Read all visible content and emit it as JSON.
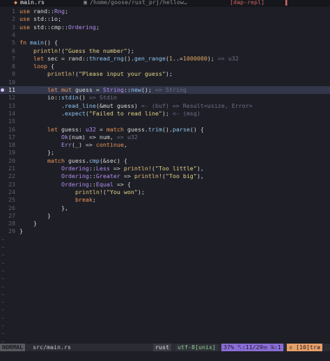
{
  "tabline": {
    "active_tab": {
      "icon": "rust-file-icon",
      "label": "main.rs"
    },
    "path_tab": {
      "icon": "folder-icon",
      "label": "/home/goose/rust_prj/hellow…"
    },
    "dap_tab": {
      "label": "[dap-repl]"
    },
    "close_glyph": "▌"
  },
  "editor": {
    "lines": [
      {
        "n": "1",
        "segs": [
          [
            "kw",
            "use "
          ],
          [
            "pl",
            "rand::"
          ],
          [
            "typ",
            "Rng"
          ],
          [
            "pl",
            ";"
          ]
        ]
      },
      {
        "n": "2",
        "segs": [
          [
            "kw",
            "use "
          ],
          [
            "pl",
            "std::"
          ],
          [
            "pl",
            "io"
          ],
          [
            "pl",
            ";"
          ]
        ]
      },
      {
        "n": "3",
        "segs": [
          [
            "kw",
            "use "
          ],
          [
            "pl",
            "std::cmp::"
          ],
          [
            "typ",
            "Ordering"
          ],
          [
            "pl",
            ";"
          ]
        ]
      },
      {
        "n": "4",
        "segs": []
      },
      {
        "n": "5",
        "segs": [
          [
            "kw",
            "fn "
          ],
          [
            "fn",
            "main"
          ],
          [
            "pl",
            "() {"
          ]
        ]
      },
      {
        "n": "6",
        "segs": [
          [
            "pl",
            "    "
          ],
          [
            "mac",
            "println!"
          ],
          [
            "pl",
            "("
          ],
          [
            "str",
            "\"Guess the number\""
          ],
          [
            "pl",
            ");"
          ]
        ]
      },
      {
        "n": "7",
        "segs": [
          [
            "pl",
            "    "
          ],
          [
            "kw",
            "let "
          ],
          [
            "pl",
            "sec = rand::"
          ],
          [
            "fn",
            "thread_rng"
          ],
          [
            "pl",
            "()."
          ],
          [
            "fn",
            "gen_range"
          ],
          [
            "pl",
            "("
          ],
          [
            "num",
            "1"
          ],
          [
            "pl",
            "..="
          ],
          [
            "num",
            "1000000"
          ],
          [
            "pl",
            ");"
          ],
          [
            "hint",
            " => u32"
          ]
        ]
      },
      {
        "n": "8",
        "segs": [
          [
            "pl",
            "    "
          ],
          [
            "kw",
            "loop "
          ],
          [
            "pl",
            "{"
          ]
        ]
      },
      {
        "n": "9",
        "segs": [
          [
            "pl",
            "        "
          ],
          [
            "mac",
            "println!"
          ],
          [
            "pl",
            "("
          ],
          [
            "str",
            "\"Please input your guess\""
          ],
          [
            "pl",
            ");"
          ]
        ]
      },
      {
        "n": "10",
        "segs": []
      },
      {
        "n": "11",
        "cur": true,
        "bp": true,
        "segs": [
          [
            "pl",
            "        "
          ],
          [
            "kw",
            "let mut "
          ],
          [
            "pl",
            "guess = "
          ],
          [
            "typ",
            "String"
          ],
          [
            "pl",
            "::"
          ],
          [
            "fn",
            "new"
          ],
          [
            "pl",
            "();"
          ],
          [
            "hint",
            " => String"
          ]
        ]
      },
      {
        "n": "12",
        "segs": [
          [
            "pl",
            "        io::"
          ],
          [
            "fn",
            "stdin"
          ],
          [
            "pl",
            "()"
          ],
          [
            "hint",
            " => Stdin"
          ]
        ]
      },
      {
        "n": "13",
        "segs": [
          [
            "pl",
            "            ."
          ],
          [
            "fn",
            "read_line"
          ],
          [
            "pl",
            "(&mut guess)"
          ],
          [
            "hint",
            " <- (buf) => Result<usize, Error>"
          ]
        ]
      },
      {
        "n": "14",
        "segs": [
          [
            "pl",
            "            ."
          ],
          [
            "fn",
            "expect"
          ],
          [
            "pl",
            "("
          ],
          [
            "str",
            "\"Failed to read line\""
          ],
          [
            "pl",
            ");"
          ],
          [
            "hint",
            " <- (msg)"
          ]
        ]
      },
      {
        "n": "15",
        "segs": []
      },
      {
        "n": "16",
        "segs": [
          [
            "pl",
            "        "
          ],
          [
            "kw",
            "let "
          ],
          [
            "pl",
            "guess: "
          ],
          [
            "typ",
            "u32"
          ],
          [
            "pl",
            " = "
          ],
          [
            "kw",
            "match "
          ],
          [
            "pl",
            "guess."
          ],
          [
            "fn",
            "trim"
          ],
          [
            "pl",
            "()."
          ],
          [
            "fn",
            "parse"
          ],
          [
            "pl",
            "() {"
          ]
        ]
      },
      {
        "n": "17",
        "segs": [
          [
            "pl",
            "            "
          ],
          [
            "typ",
            "Ok"
          ],
          [
            "pl",
            "(num) => num,"
          ],
          [
            "hint",
            " => u32"
          ]
        ]
      },
      {
        "n": "18",
        "segs": [
          [
            "pl",
            "            "
          ],
          [
            "typ",
            "Err"
          ],
          [
            "pl",
            "(_) => "
          ],
          [
            "kw",
            "continue"
          ],
          [
            "pl",
            ","
          ]
        ]
      },
      {
        "n": "19",
        "segs": [
          [
            "pl",
            "        };"
          ]
        ]
      },
      {
        "n": "20",
        "segs": [
          [
            "pl",
            "        "
          ],
          [
            "kw",
            "match "
          ],
          [
            "pl",
            "guess."
          ],
          [
            "fn",
            "cmp"
          ],
          [
            "pl",
            "(&sec) {"
          ]
        ]
      },
      {
        "n": "21",
        "segs": [
          [
            "pl",
            "            "
          ],
          [
            "typ",
            "Ordering"
          ],
          [
            "pl",
            "::"
          ],
          [
            "typ",
            "Less"
          ],
          [
            "pl",
            " => "
          ],
          [
            "mac",
            "println!"
          ],
          [
            "pl",
            "("
          ],
          [
            "str",
            "\"Too little\""
          ],
          [
            "pl",
            "),"
          ]
        ]
      },
      {
        "n": "22",
        "segs": [
          [
            "pl",
            "            "
          ],
          [
            "typ",
            "Ordering"
          ],
          [
            "pl",
            "::"
          ],
          [
            "typ",
            "Greater"
          ],
          [
            "pl",
            " => "
          ],
          [
            "mac",
            "println!"
          ],
          [
            "pl",
            "("
          ],
          [
            "str",
            "\"Too big\""
          ],
          [
            "pl",
            "),"
          ]
        ]
      },
      {
        "n": "23",
        "segs": [
          [
            "pl",
            "            "
          ],
          [
            "typ",
            "Ordering"
          ],
          [
            "pl",
            "::"
          ],
          [
            "typ",
            "Equal"
          ],
          [
            "pl",
            " => {"
          ]
        ]
      },
      {
        "n": "24",
        "segs": [
          [
            "pl",
            "                "
          ],
          [
            "mac",
            "println!"
          ],
          [
            "pl",
            "("
          ],
          [
            "str",
            "\"You won\""
          ],
          [
            "pl",
            ");"
          ]
        ]
      },
      {
        "n": "25",
        "segs": [
          [
            "pl",
            "                "
          ],
          [
            "kw",
            "break"
          ],
          [
            "pl",
            ";"
          ]
        ]
      },
      {
        "n": "26",
        "segs": [
          [
            "pl",
            "            },"
          ]
        ]
      },
      {
        "n": "27",
        "segs": [
          [
            "pl",
            "        }"
          ]
        ]
      },
      {
        "n": "28",
        "segs": [
          [
            "pl",
            "    }"
          ]
        ]
      },
      {
        "n": "29",
        "segs": [
          [
            "pl",
            "}"
          ]
        ]
      }
    ],
    "tilde_count": 14,
    "tilde_char": "~"
  },
  "statusline": {
    "mode": "NORMAL",
    "file": "src/main.rs",
    "filetype": "rust",
    "encoding": "utf-8[unix]",
    "position": "37% ␤:11/29☰ ℅:1",
    "terminal": "▫ [10]tra"
  },
  "colors": {
    "background": "#1e1f26",
    "keyword": "#e8945a",
    "string": "#e3d48a",
    "type": "#b48ef5",
    "function": "#8cc3f0",
    "hint": "#6c7088",
    "cursor_line": "#33374a"
  }
}
